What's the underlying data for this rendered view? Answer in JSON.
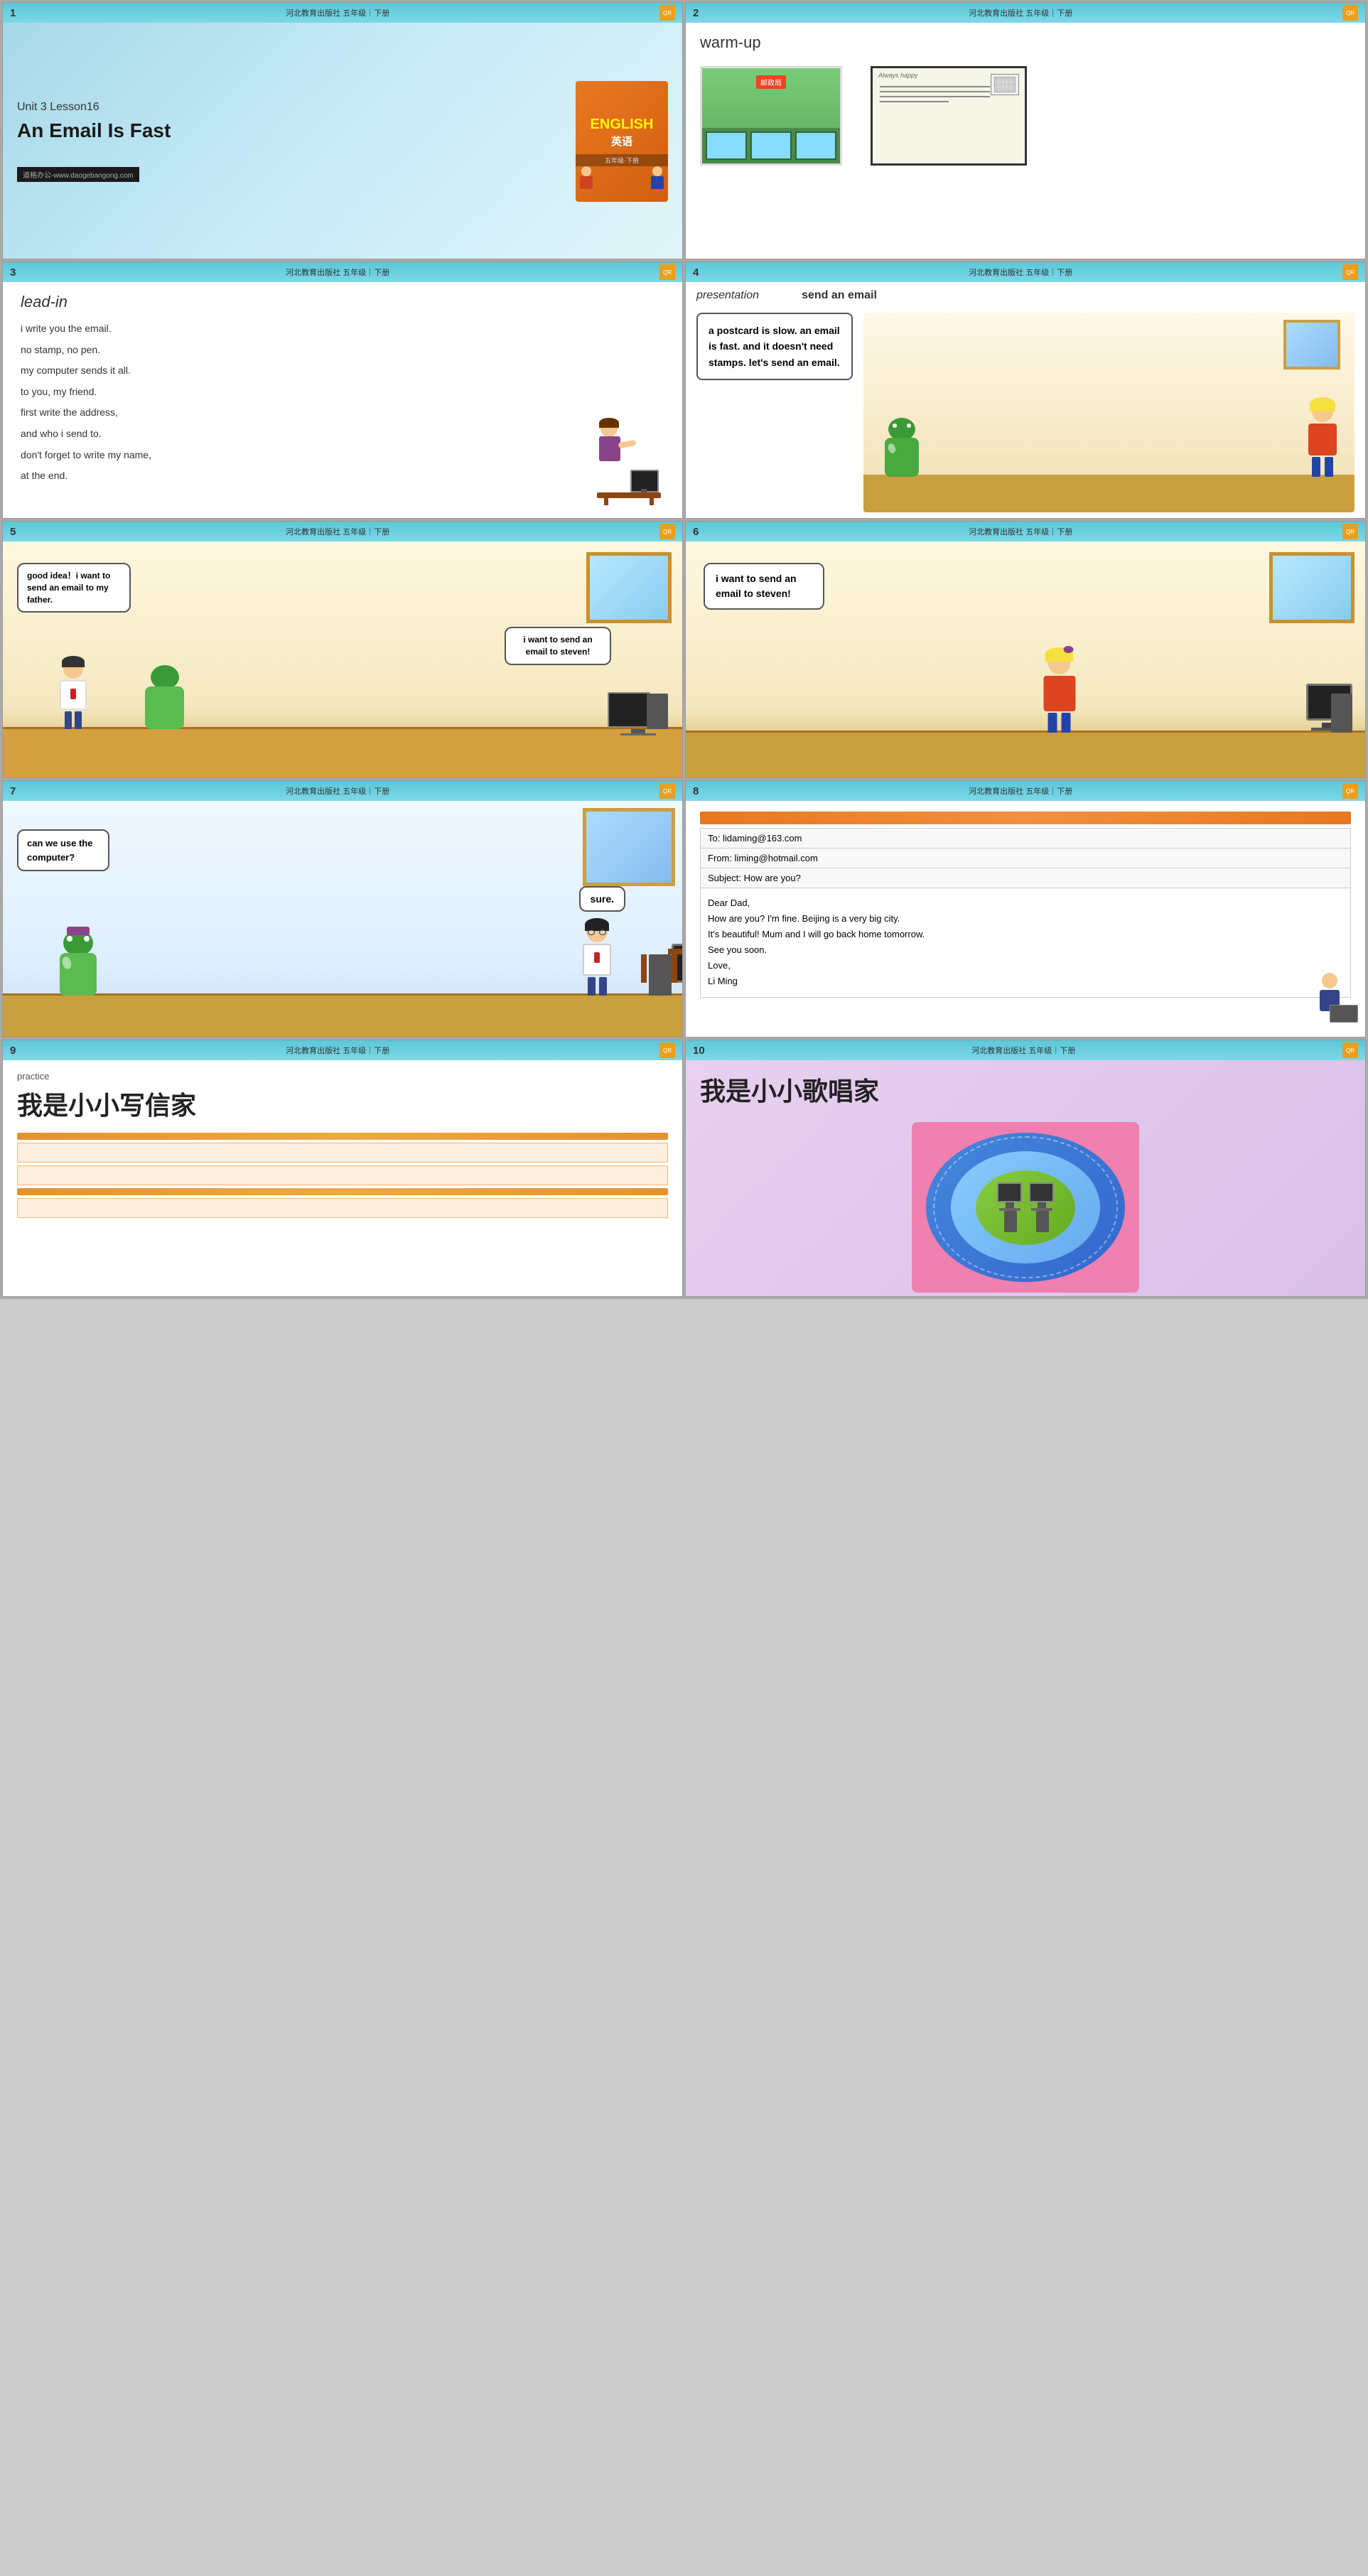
{
  "slides": [
    {
      "number": "1",
      "publisher": "河北教育出版社 五年级｜下册",
      "unit": "Unit 3  Lesson16",
      "title": "An Email Is Fast",
      "footer": "道格办公-www.daogebangong.com",
      "book_title": "ENGLISH\n英语",
      "book_sub": "五年级·下册"
    },
    {
      "number": "2",
      "publisher": "河北教育出版社 五年级｜下册",
      "heading": "warm-up",
      "img1_label": "邮政局",
      "img2_label": "Always happy"
    },
    {
      "number": "3",
      "publisher": "河北教育出版社 五年级｜下册",
      "heading": "lead-in",
      "lines": [
        "i write you the email.",
        "no stamp, no pen.",
        "my computer sends it all.",
        "to you, my friend.",
        "first write the address,",
        "and who i send to.",
        "don't forget to write my name,",
        "at the end."
      ]
    },
    {
      "number": "4",
      "publisher": "河北教育出版社 五年级｜下册",
      "label1": "presentation",
      "label2": "send an email",
      "bubble_text": "a postcard is slow. an email is fast. and it doesn't need stamps. let's send an email."
    },
    {
      "number": "5",
      "publisher": "河北教育出版社 五年级｜下册",
      "bubble1": "good idea！i want to send an email to my father.",
      "bubble2": "i want to send an email to steven!"
    },
    {
      "number": "6",
      "publisher": "河北教育出版社 五年级｜下册",
      "bubble": "i want to send an email to steven!"
    },
    {
      "number": "7",
      "publisher": "河北教育出版社 五年级｜下册",
      "bubble_left": "can we use the computer?",
      "bubble_right": "sure."
    },
    {
      "number": "8",
      "publisher": "河北教育出版社 五年级｜下册",
      "email": {
        "to": "To: lidaming@163.com",
        "from": "From: liming@hotmail.com",
        "subject": "Subject: How are you?",
        "body_lines": [
          "Dear Dad,",
          "How are you? I'm fine. Beijing is a very big city.",
          "It's beautiful! Mum and I will go back home tomorrow.",
          "See you soon.",
          "Love,",
          "Li Ming"
        ]
      }
    },
    {
      "number": "9",
      "publisher": "河北教育出版社 五年级｜下册",
      "practice_label": "practice",
      "title": "我是小小写信家"
    },
    {
      "number": "10",
      "publisher": "河北教育出版社 五年级｜下册",
      "title": "我是小小歌唱家"
    }
  ],
  "icon_label": "QR"
}
